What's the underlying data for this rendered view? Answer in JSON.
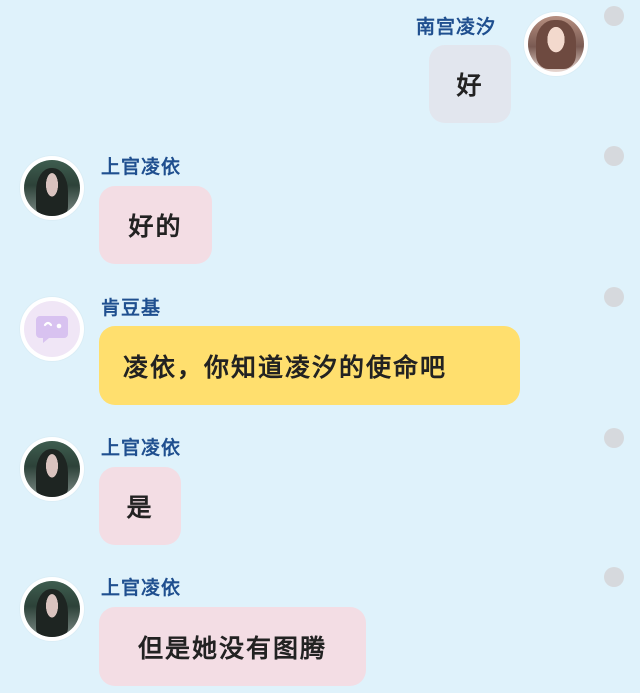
{
  "messages": [
    {
      "sender": "南宫凌汐",
      "text": "好",
      "side": "right",
      "bubble_color": "#e2e6ee"
    },
    {
      "sender": "上官凌依",
      "text": "好的",
      "side": "left",
      "bubble_color": "#f3dde4"
    },
    {
      "sender": "肯豆基",
      "text": "凌依，你知道凌汐的使命吧",
      "side": "left",
      "bubble_color": "#ffdf6e"
    },
    {
      "sender": "上官凌依",
      "text": "是",
      "side": "left",
      "bubble_color": "#f3dde4"
    },
    {
      "sender": "上官凌依",
      "text": "但是她没有图腾",
      "side": "left",
      "bubble_color": "#f3dde4"
    }
  ],
  "colors": {
    "background": "#dff2fb",
    "name_text": "#1f4f8f",
    "dot": "#d6d9dd"
  },
  "icons": [
    "avatar-photo",
    "bot-chat-icon",
    "more-options-dot"
  ]
}
